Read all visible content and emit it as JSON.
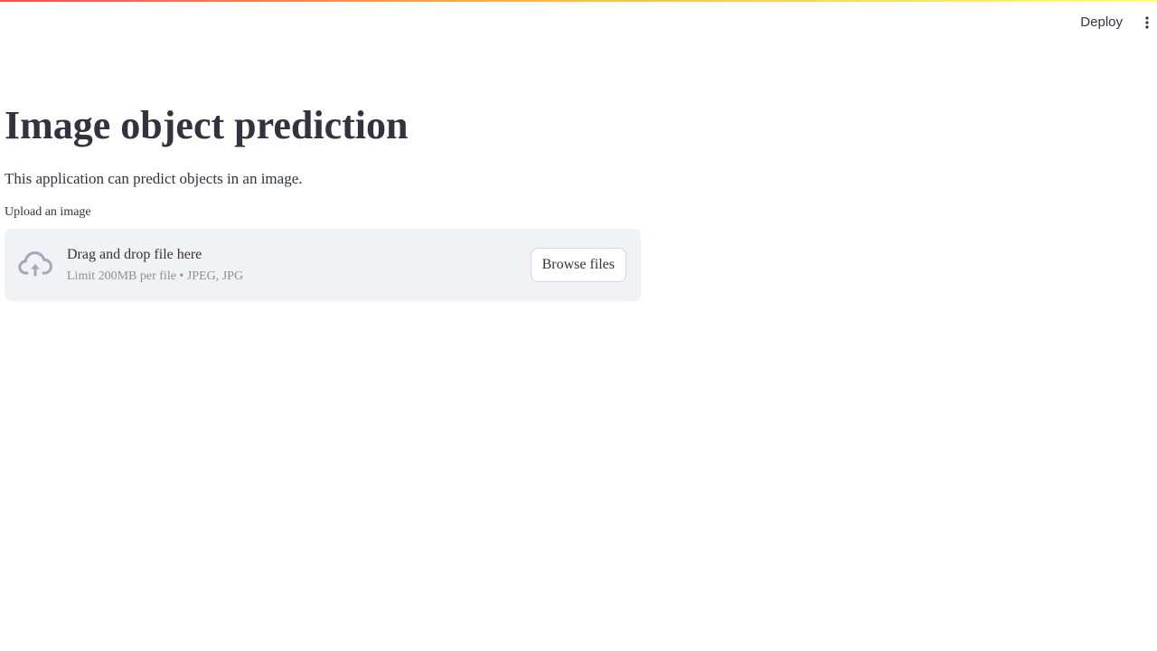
{
  "header": {
    "deploy_label": "Deploy",
    "menu_icon": "vertical-ellipsis-icon",
    "decoration_colors": [
      "#ff4b4b",
      "#ffbd45",
      "#fffd80"
    ]
  },
  "main": {
    "title": "Image object prediction",
    "description": "This application can predict objects in an image."
  },
  "uploader": {
    "label": "Upload an image",
    "icon": "cloud-upload-icon",
    "dropzone_title": "Drag and drop file here",
    "dropzone_limit": "Limit 200MB per file • JPEG, JPG",
    "browse_label": "Browse files"
  },
  "colors": {
    "text": "#31333f",
    "muted": "#8d8f99",
    "dropzone_bg": "#f0f2f6",
    "icon": "#a3a8b8"
  }
}
